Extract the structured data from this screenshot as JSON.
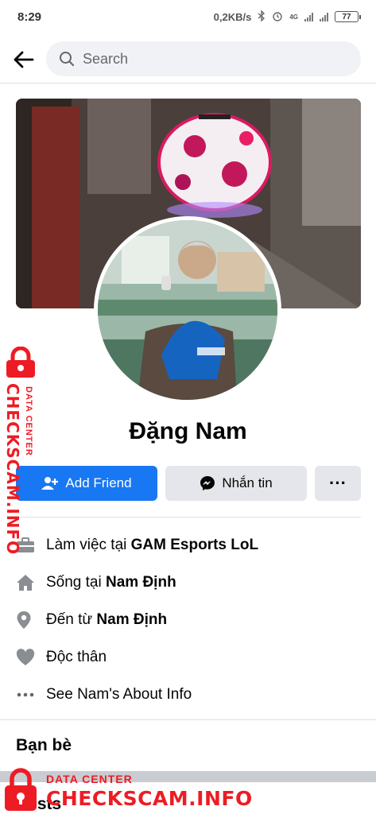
{
  "status_bar": {
    "time": "8:29",
    "speed": "0,2KB/s",
    "network": "4G",
    "battery": "77"
  },
  "search": {
    "placeholder": "Search"
  },
  "profile": {
    "name": "Đặng Nam"
  },
  "actions": {
    "add_friend": "Add Friend",
    "message": "Nhắn tin",
    "more": "···"
  },
  "info": {
    "work_prefix": "Làm việc tại ",
    "work_value": "GAM Esports LoL",
    "lives_prefix": "Sống tại ",
    "lives_value": "Nam Định",
    "from_prefix": "Đến từ ",
    "from_value": "Nam Định",
    "relationship": "Độc thân",
    "about_link": "See Nam's About Info"
  },
  "sections": {
    "friends": "Bạn bè",
    "posts": "Posts"
  },
  "watermark": {
    "small": "DATA CENTER",
    "big": "CHECKSCAM.INFO"
  },
  "colors": {
    "accent": "#1877f2",
    "secondary_button": "#e4e6eb",
    "watermark": "#ed1c24"
  }
}
